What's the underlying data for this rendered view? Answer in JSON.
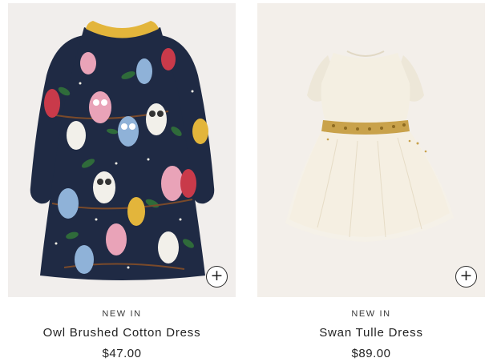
{
  "products": [
    {
      "badge": "NEW IN",
      "name": "Owl Brushed Cotton Dress",
      "price": "$47.00",
      "add_icon": "plus-icon",
      "colors": {
        "navy": "#1f2a44",
        "collar": "#e3b53b",
        "background": "#f1eeec"
      }
    },
    {
      "badge": "NEW IN",
      "name": "Swan Tulle Dress",
      "price": "$89.00",
      "add_icon": "plus-icon",
      "colors": {
        "ivory": "#f4efe2",
        "sequin": "#b9923b",
        "background": "#f3efea"
      }
    }
  ],
  "add_button_glyph": "+"
}
